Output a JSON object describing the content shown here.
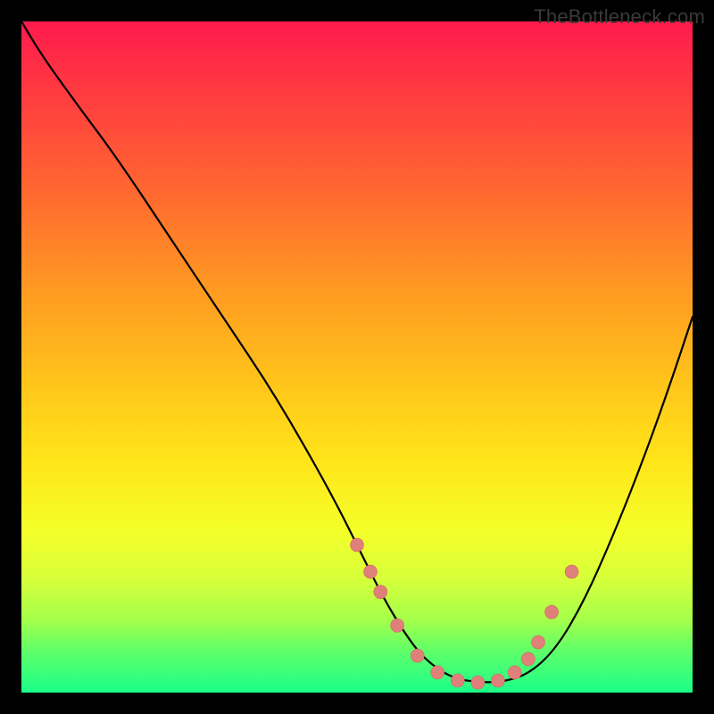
{
  "watermark": "TheBottleneck.com",
  "colors": {
    "page_bg": "#000000",
    "curve": "#000000",
    "marker_fill": "#e0807b",
    "marker_stroke": "#d56660",
    "gradient_stops": [
      "#ff1a4d",
      "#ff3f3f",
      "#ff6a2f",
      "#ff9a22",
      "#ffc51a",
      "#ffe61a",
      "#f4ff2a",
      "#d7ff3a",
      "#a6ff4a",
      "#5dff6a",
      "#1aff88"
    ]
  },
  "chart_data": {
    "type": "line",
    "title": "",
    "xlabel": "",
    "ylabel": "",
    "xlim": [
      0,
      100
    ],
    "ylim": [
      0,
      100
    ],
    "grid": false,
    "legend": false,
    "series": [
      {
        "name": "bottleneck-curve",
        "x": [
          0,
          3,
          8,
          14,
          22,
          30,
          38,
          46,
          51,
          54,
          57,
          60,
          64,
          68,
          72,
          76,
          80,
          84,
          88,
          92,
          96,
          100
        ],
        "y": [
          100,
          95,
          88,
          80,
          68,
          56,
          44,
          30,
          20,
          14,
          9,
          5,
          2.2,
          1.5,
          1.6,
          3,
          7,
          14,
          23,
          33,
          44,
          56
        ]
      }
    ],
    "markers": {
      "name": "highlight-points",
      "x": [
        50,
        52,
        53.5,
        56,
        59,
        62,
        65,
        68,
        71,
        73.5,
        75.5,
        77,
        79,
        82
      ],
      "y": [
        22,
        18,
        15,
        10,
        5.5,
        3,
        1.8,
        1.5,
        1.8,
        3,
        5,
        7.5,
        12,
        18
      ]
    }
  }
}
